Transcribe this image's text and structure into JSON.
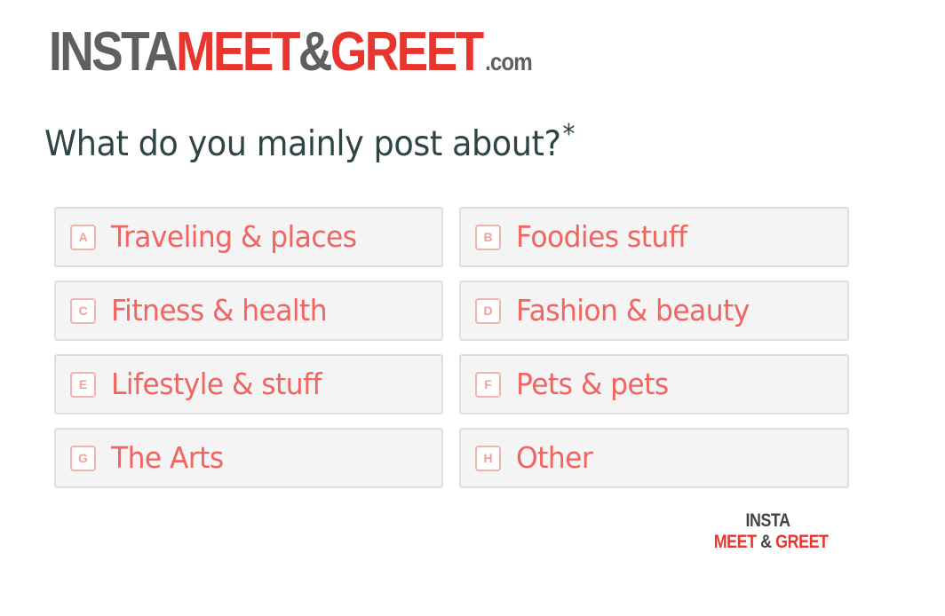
{
  "header": {
    "logo": {
      "part1": "INSTA",
      "part2": "MEET",
      "part3": "&",
      "part4": "GREET",
      "part5": ".com"
    }
  },
  "question": {
    "text": "What do you mainly post about?",
    "required_marker": "*"
  },
  "options": [
    {
      "key": "A",
      "label": "Traveling & places"
    },
    {
      "key": "B",
      "label": "Foodies stuff"
    },
    {
      "key": "C",
      "label": "Fitness & health"
    },
    {
      "key": "D",
      "label": "Fashion & beauty"
    },
    {
      "key": "E",
      "label": "Lifestyle & stuff"
    },
    {
      "key": "F",
      "label": "Pets & pets"
    },
    {
      "key": "G",
      "label": "The Arts"
    },
    {
      "key": "H",
      "label": "Other"
    }
  ],
  "footer": {
    "logo": {
      "top": "INSTA",
      "meet": "MEET",
      "amp": "&",
      "greet": "GREET"
    }
  },
  "colors": {
    "brand_red": "#e8352e",
    "brand_gray": "#5f5f5f",
    "option_text": "#ef6561",
    "question_text": "#2f4545"
  }
}
